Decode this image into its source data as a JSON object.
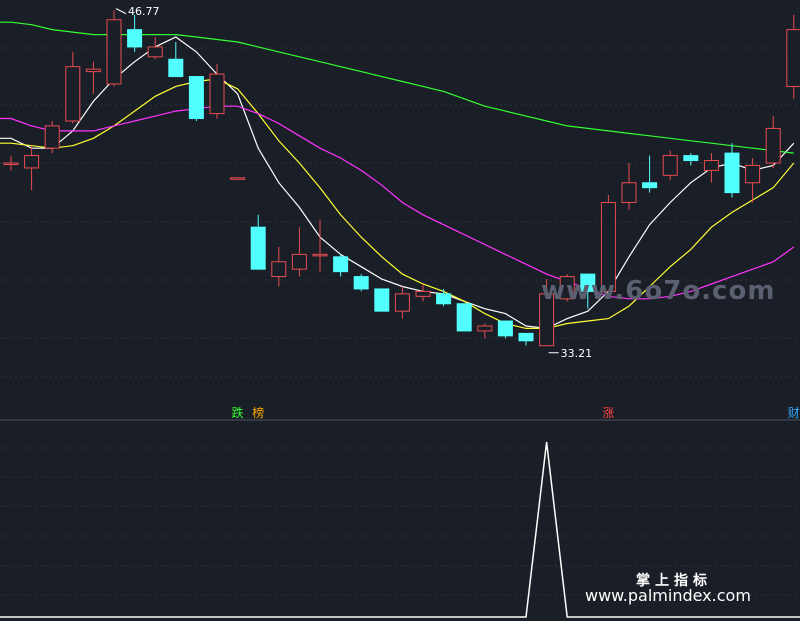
{
  "colors": {
    "background": "#1a1e26",
    "grid": "#2c3140",
    "up": "#e84d52",
    "down": "#52ffff",
    "ma5": "#ffffff",
    "ma10": "#ffff33",
    "ma20": "#ff33ff",
    "ma60": "#33ff33",
    "indicator": "#ffffff"
  },
  "chart_data": {
    "type": "candlestick",
    "price_range": [
      30.8,
      47.2
    ],
    "high_label": "46.77",
    "low_label": "33.21",
    "candles": [
      {
        "o": 40.6,
        "c": 40.6,
        "h": 40.9,
        "l": 40.3
      },
      {
        "o": 40.4,
        "c": 40.9,
        "h": 41.3,
        "l": 39.5
      },
      {
        "o": 41.2,
        "c": 42.1,
        "h": 42.3,
        "l": 41.0
      },
      {
        "o": 42.3,
        "c": 44.5,
        "h": 45.1,
        "l": 42.2
      },
      {
        "o": 44.3,
        "c": 44.4,
        "h": 44.7,
        "l": 43.4
      },
      {
        "o": 43.8,
        "c": 46.4,
        "h": 46.77,
        "l": 43.7
      },
      {
        "o": 46.0,
        "c": 45.3,
        "h": 46.6,
        "l": 45.1
      },
      {
        "o": 44.9,
        "c": 45.3,
        "h": 45.7,
        "l": 44.8
      },
      {
        "o": 44.8,
        "c": 44.1,
        "h": 45.5,
        "l": 44.1
      },
      {
        "o": 44.1,
        "c": 42.4,
        "h": 44.1,
        "l": 42.3
      },
      {
        "o": 42.6,
        "c": 44.2,
        "h": 44.6,
        "l": 42.4
      },
      {
        "o": 40.0,
        "c": 40.0,
        "h": 40.0,
        "l": 40.0
      },
      {
        "o": 38.0,
        "c": 36.3,
        "h": 38.5,
        "l": 36.3
      },
      {
        "o": 36.0,
        "c": 36.6,
        "h": 37.2,
        "l": 35.6
      },
      {
        "o": 36.3,
        "c": 36.9,
        "h": 38.0,
        "l": 36.0
      },
      {
        "o": 36.9,
        "c": 36.9,
        "h": 38.3,
        "l": 36.2
      },
      {
        "o": 36.8,
        "c": 36.2,
        "h": 36.9,
        "l": 36.0
      },
      {
        "o": 36.0,
        "c": 35.5,
        "h": 36.1,
        "l": 35.4
      },
      {
        "o": 35.5,
        "c": 34.6,
        "h": 35.5,
        "l": 34.6
      },
      {
        "o": 34.6,
        "c": 35.3,
        "h": 35.6,
        "l": 34.3
      },
      {
        "o": 35.2,
        "c": 35.4,
        "h": 35.7,
        "l": 35.0
      },
      {
        "o": 35.3,
        "c": 34.9,
        "h": 35.5,
        "l": 34.8
      },
      {
        "o": 34.9,
        "c": 33.8,
        "h": 34.9,
        "l": 33.8
      },
      {
        "o": 33.8,
        "c": 34.0,
        "h": 34.1,
        "l": 33.5
      },
      {
        "o": 34.2,
        "c": 33.6,
        "h": 34.2,
        "l": 33.5
      },
      {
        "o": 33.7,
        "c": 33.4,
        "h": 33.7,
        "l": 33.21
      },
      {
        "o": 33.2,
        "c": 35.3,
        "h": 35.9,
        "l": 33.2
      },
      {
        "o": 35.1,
        "c": 36.0,
        "h": 36.1,
        "l": 35.0
      },
      {
        "o": 36.1,
        "c": 35.4,
        "h": 36.1,
        "l": 34.7
      },
      {
        "o": 35.4,
        "c": 39.0,
        "h": 39.3,
        "l": 35.3
      },
      {
        "o": 39.0,
        "c": 39.8,
        "h": 40.6,
        "l": 38.7
      },
      {
        "o": 39.8,
        "c": 39.6,
        "h": 40.9,
        "l": 39.4
      },
      {
        "o": 40.1,
        "c": 40.9,
        "h": 41.1,
        "l": 39.9
      },
      {
        "o": 40.9,
        "c": 40.7,
        "h": 41.0,
        "l": 40.5
      },
      {
        "o": 40.3,
        "c": 40.7,
        "h": 41.0,
        "l": 39.8
      },
      {
        "o": 41.0,
        "c": 39.4,
        "h": 41.4,
        "l": 39.2
      },
      {
        "o": 39.8,
        "c": 40.5,
        "h": 40.8,
        "l": 39.0
      },
      {
        "o": 40.6,
        "c": 42.0,
        "h": 42.5,
        "l": 40.4
      },
      {
        "o": 43.7,
        "c": 46.0,
        "h": 46.6,
        "l": 43.2
      }
    ],
    "ma_lines": [
      {
        "name": "MA5",
        "values": [
          41.6,
          41.2,
          41.2,
          41.9,
          43.1,
          44.0,
          44.7,
          45.3,
          45.7,
          45.1,
          44.2,
          43.4,
          41.2,
          39.8,
          38.8,
          37.6,
          36.9,
          36.4,
          35.9,
          35.6,
          35.4,
          35.3,
          35.0,
          34.7,
          34.5,
          34.0,
          33.9,
          34.3,
          34.6,
          35.4,
          36.8,
          38.1,
          39.0,
          39.8,
          40.4,
          40.6,
          40.3,
          40.5,
          41.4
        ]
      },
      {
        "name": "MA10",
        "values": [
          41.4,
          41.3,
          41.2,
          41.3,
          41.6,
          42.1,
          42.7,
          43.3,
          43.7,
          43.9,
          44.0,
          43.6,
          42.6,
          41.5,
          40.6,
          39.6,
          38.5,
          37.6,
          36.8,
          36.1,
          35.7,
          35.4,
          35.0,
          34.5,
          34.1,
          33.9,
          33.9,
          34.1,
          34.2,
          34.3,
          34.8,
          35.6,
          36.4,
          37.1,
          38.0,
          38.6,
          39.1,
          39.6,
          40.6
        ]
      },
      {
        "name": "MA20",
        "values": [
          42.4,
          42.1,
          41.9,
          41.9,
          41.9,
          42.1,
          42.3,
          42.5,
          42.7,
          42.8,
          42.9,
          42.9,
          42.6,
          42.2,
          41.7,
          41.2,
          40.8,
          40.3,
          39.7,
          39.0,
          38.5,
          38.1,
          37.7,
          37.3,
          36.9,
          36.5,
          36.1,
          35.8,
          35.5,
          35.2,
          35.1,
          35.1,
          35.2,
          35.4,
          35.7,
          36.0,
          36.3,
          36.6,
          37.2
        ]
      },
      {
        "name": "MA60",
        "values": [
          46.3,
          46.2,
          46.0,
          45.9,
          45.8,
          45.8,
          45.8,
          45.8,
          45.8,
          45.7,
          45.6,
          45.5,
          45.3,
          45.1,
          44.9,
          44.7,
          44.5,
          44.3,
          44.1,
          43.9,
          43.7,
          43.5,
          43.2,
          42.9,
          42.7,
          42.5,
          42.3,
          42.1,
          42.0,
          41.9,
          41.8,
          41.7,
          41.6,
          41.5,
          41.4,
          41.3,
          41.2,
          41.1,
          41.0
        ]
      }
    ],
    "markers": [
      {
        "index": 11,
        "text": "跌",
        "color": "#33ff33"
      },
      {
        "index": 12,
        "text": "榜",
        "color": "#ffaa00"
      },
      {
        "index": 29,
        "text": "涨",
        "color": "#ff4444"
      },
      {
        "index": 38,
        "text": "财",
        "color": "#33aaff"
      }
    ],
    "indicator": {
      "range": [
        0,
        1
      ],
      "values": [
        0,
        0,
        0,
        0,
        0,
        0,
        0,
        0,
        0,
        0,
        0,
        0,
        0,
        0,
        0,
        0,
        0,
        0,
        0,
        0,
        0,
        0,
        0,
        0,
        0,
        0,
        1,
        0,
        0,
        0,
        0,
        0,
        0,
        0,
        0,
        0,
        0,
        0,
        0
      ]
    }
  },
  "watermarks": {
    "site_6o7o": "www.6o7o.com",
    "palm_title": "掌上指标",
    "palm_url": "www.palmindex.com"
  }
}
